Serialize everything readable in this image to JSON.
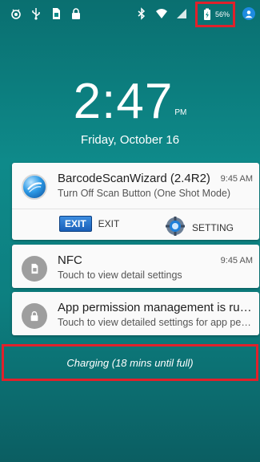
{
  "status_bar": {
    "left_icons": [
      "android-debug-icon",
      "usb-icon",
      "sim-card-icon",
      "lock-icon"
    ],
    "right_icons": [
      "bluetooth-icon",
      "wifi-icon",
      "signal-icon"
    ],
    "battery_percent": "56%"
  },
  "clock": {
    "time": "2:47",
    "ampm": "PM",
    "date": "Friday, October 16"
  },
  "notifications": [
    {
      "title": "BarcodeScanWizard (2.4R2)",
      "time": "9:45 AM",
      "subtitle": "Turn Off Scan Button (One Shot Mode)",
      "actions": [
        {
          "badge": "EXIT",
          "label": "EXIT"
        },
        {
          "label": "SETTING"
        }
      ]
    },
    {
      "title": "NFC",
      "time": "9:45 AM",
      "subtitle": "Touch to view detail settings"
    },
    {
      "title": "App permission management is running",
      "subtitle": "Touch to view detailed settings for app permissions"
    }
  ],
  "charging": {
    "text": "Charging (18 mins until full)"
  },
  "colors": {
    "background": "#0e8a8a",
    "highlight_border": "#e0212b",
    "exit_badge": "#1a5fb8"
  }
}
